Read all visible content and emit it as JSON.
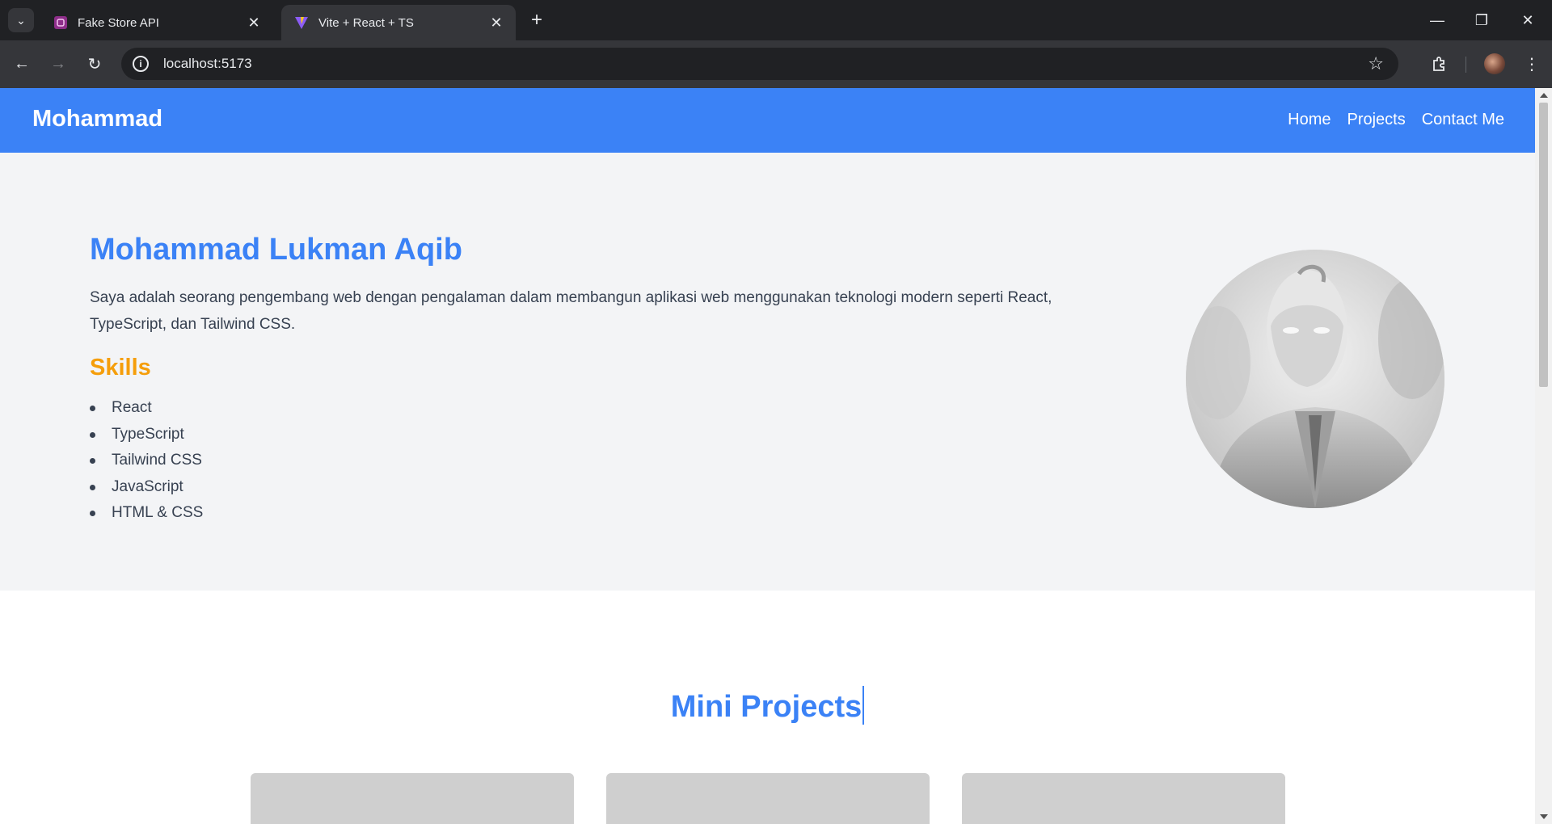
{
  "browser": {
    "tabs": [
      {
        "title": "Fake Store API",
        "favicon": "fake-store-favicon",
        "active": false
      },
      {
        "title": "Vite + React + TS",
        "favicon": "vite-favicon",
        "active": true
      }
    ],
    "url": "localhost:5173"
  },
  "site": {
    "brand": "Mohammad",
    "nav": [
      {
        "label": "Home"
      },
      {
        "label": "Projects"
      },
      {
        "label": "Contact Me"
      }
    ]
  },
  "hero": {
    "name": "Mohammad Lukman Aqib",
    "description": "Saya adalah seorang pengembang web dengan pengalaman dalam membangun aplikasi web menggunakan teknologi modern seperti React, TypeScript, dan Tailwind CSS.",
    "skills_title": "Skills",
    "skills": [
      "React",
      "TypeScript",
      "Tailwind CSS",
      "JavaScript",
      "HTML & CSS"
    ]
  },
  "projects": {
    "title": "Mini Projects"
  },
  "colors": {
    "accent": "#3b82f6",
    "skills_heading": "#f59e0b",
    "hero_bg": "#f3f4f6"
  }
}
